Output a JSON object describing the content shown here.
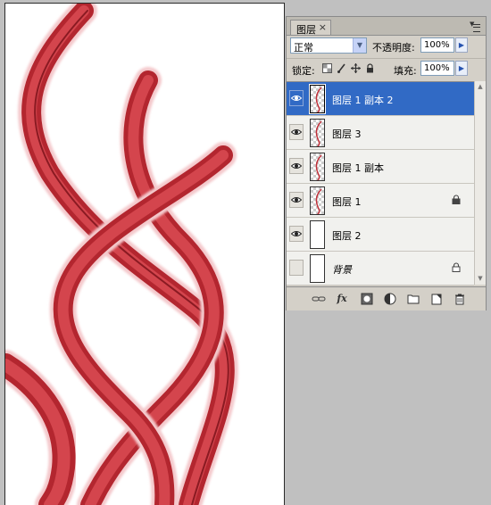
{
  "panel": {
    "tab_label": "图层",
    "tab_close": "×",
    "blend_mode": "正常",
    "opacity_label": "不透明度:",
    "opacity_value": "100%",
    "lock_label": "锁定:",
    "fill_label": "填充:",
    "fill_value": "100%"
  },
  "layers": [
    {
      "name": "图层 1 副本 2",
      "visible": true,
      "selected": true,
      "locked": false,
      "italic": false
    },
    {
      "name": "图层 3",
      "visible": true,
      "selected": false,
      "locked": false,
      "italic": false
    },
    {
      "name": "图层 1 副本",
      "visible": true,
      "selected": false,
      "locked": false,
      "italic": false
    },
    {
      "name": "图层 1",
      "visible": true,
      "selected": false,
      "locked": true,
      "italic": false
    },
    {
      "name": "图层 2",
      "visible": true,
      "selected": false,
      "locked": false,
      "italic": false
    },
    {
      "name": "背景",
      "visible": false,
      "selected": false,
      "locked": true,
      "italic": true
    }
  ],
  "toolbar": {
    "icons": [
      "link-layers-icon",
      "fx-icon",
      "add-mask-icon",
      "adjustment-layer-icon",
      "new-group-icon",
      "new-layer-icon",
      "trash-icon"
    ],
    "fx_label": "fx"
  },
  "colors": {
    "selection": "#316ac5",
    "stroke_red": "#c0303a"
  }
}
